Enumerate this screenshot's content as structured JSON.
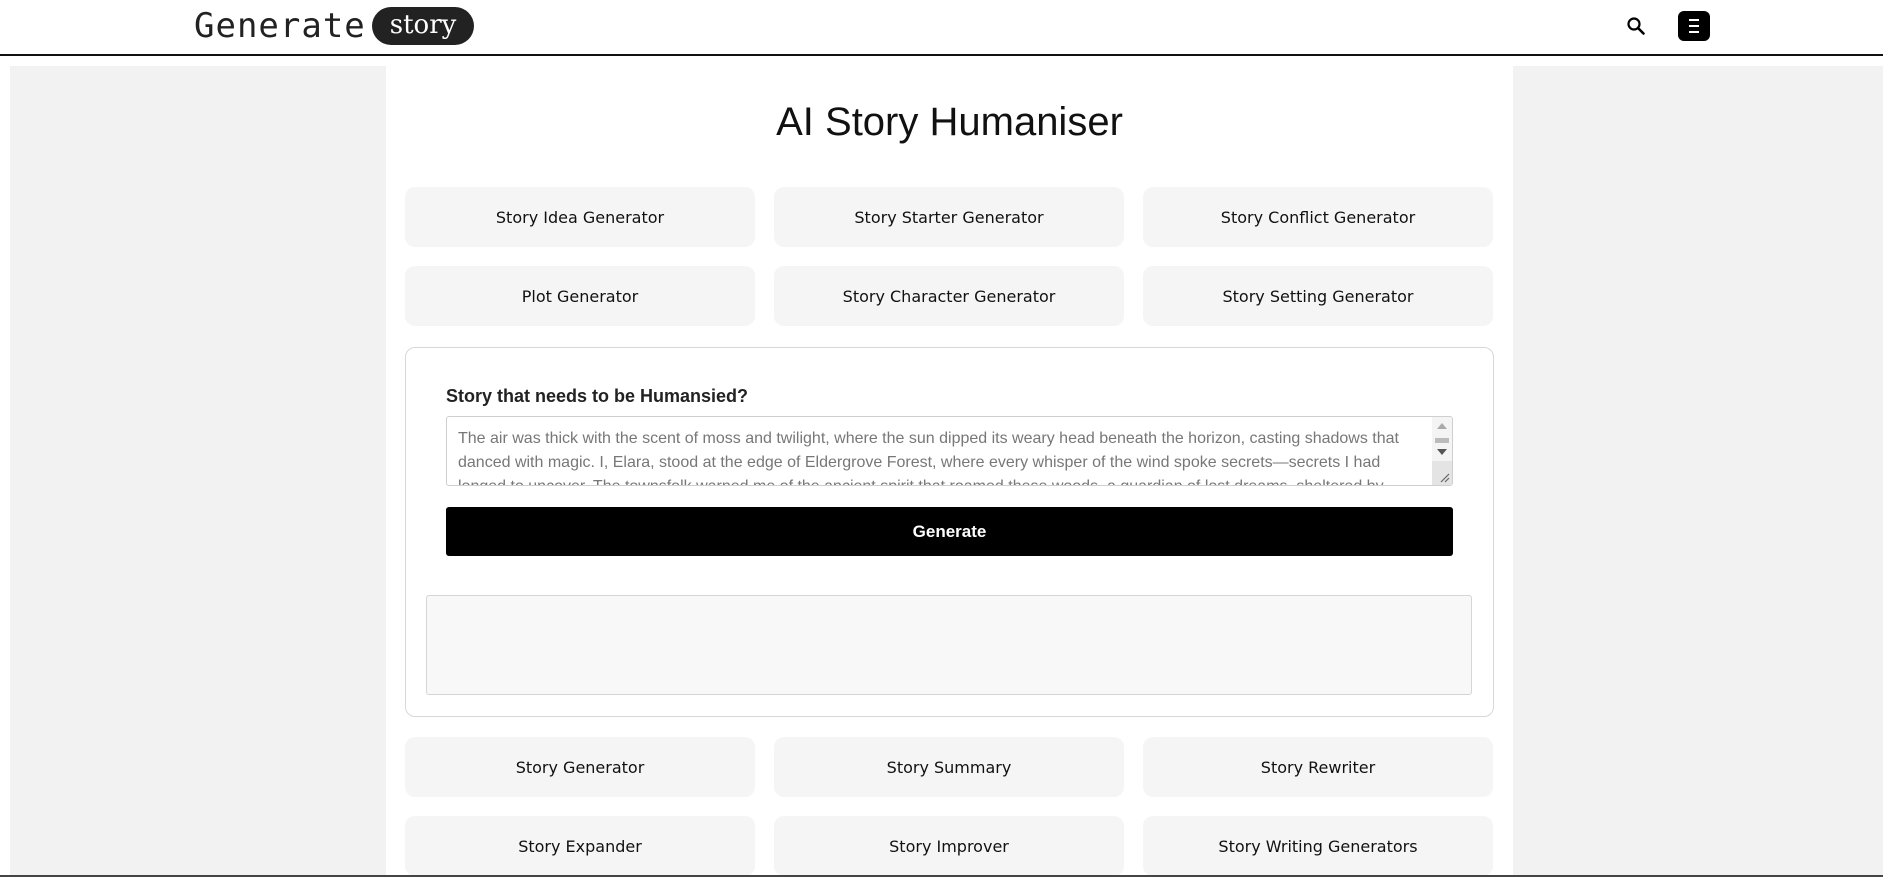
{
  "header": {
    "logo_word": "Generate",
    "logo_pill": "story",
    "search_icon": "search-icon",
    "menu_icon": "menu-icon"
  },
  "page": {
    "title": "AI Story Humaniser"
  },
  "top_links": [
    "Story Idea Generator",
    "Story Starter Generator",
    "Story Conflict Generator",
    "Plot Generator",
    "Story Character Generator",
    "Story Setting Generator"
  ],
  "form": {
    "label": "Story that needs to be Humansied?",
    "story_value": "The air was thick with the scent of moss and twilight, where the sun dipped its weary head beneath the horizon, casting shadows that danced with magic. I, Elara, stood at the edge of Eldergrove Forest, where every whisper of the wind spoke secrets—secrets I had longed to uncover. The townsfolk warned me of the ancient spirit that roamed these woods, a guardian of lost dreams, sheltered by",
    "generate_label": "Generate",
    "output": ""
  },
  "bottom_links": [
    "Story Generator",
    "Story Summary",
    "Story Rewriter",
    "Story Expander",
    "Story Improver",
    "Story Writing Generators"
  ],
  "colors": {
    "primary_button": "#000000",
    "tile_background": "#f5f5f5",
    "page_background": "#f2f2f2"
  }
}
